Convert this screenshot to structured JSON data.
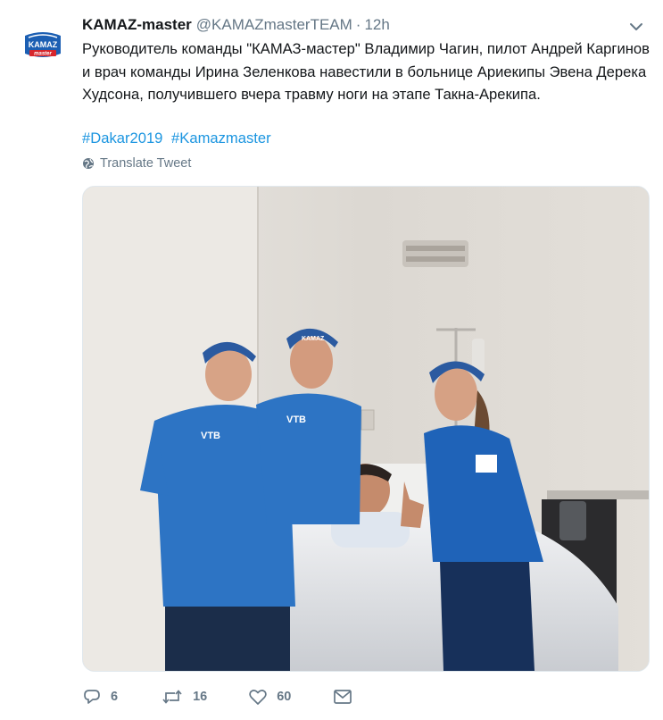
{
  "tweet": {
    "author_name": "KAMAZ-master",
    "author_handle": "@KAMAZmasterTEAM",
    "separator": "·",
    "time": "12h",
    "avatar_text": "KAMAZ",
    "avatar_subtext": "master",
    "text": "Руководитель команды \"КАМАЗ-мастер\" Владимир Чагин, пилот Андрей Каргинов и врач команды Ирина Зеленкова навестили в больнице Ариекипы Эвена Дерека Худсона, получившего вчера травму ноги на этапе Такна-Арекипа.",
    "hashtags": [
      "#Dakar2019",
      "#Kamazmaster"
    ],
    "translate_label": "Translate Tweet"
  },
  "actions": {
    "replies": "6",
    "retweets": "16",
    "likes": "60"
  },
  "photo": {
    "jersey_text": "VTB",
    "cap_text": "KAMAZ"
  },
  "colors": {
    "link": "#1b95e0",
    "muted": "#657786",
    "text": "#14171a",
    "brand_blue": "#1c5fb3"
  }
}
